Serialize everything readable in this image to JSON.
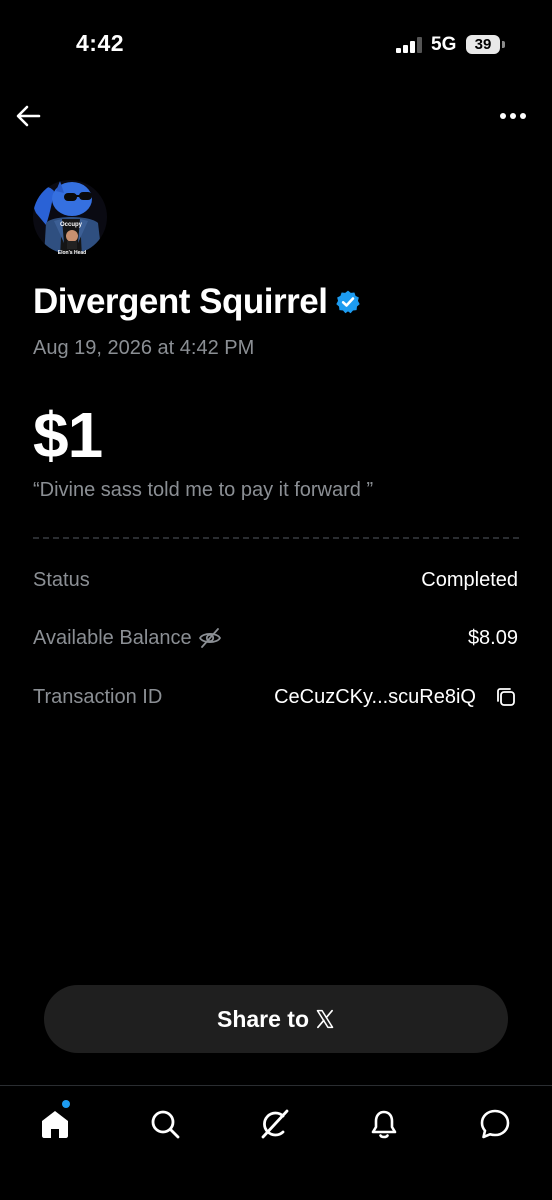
{
  "status_bar": {
    "time": "4:42",
    "network": "5G",
    "battery": "39"
  },
  "nav": {
    "back_icon": "arrow-left-icon",
    "more_icon": "more-horizontal-icon"
  },
  "profile": {
    "avatar_text_top": "Occupy",
    "avatar_text_bottom": "Elon's Head",
    "name": "Divergent Squirrel",
    "verified": true,
    "date": "Aug 19, 2026 at 4:42 PM"
  },
  "payment": {
    "amount": "$1",
    "memo": "“Divine sass told me to pay it forward ”"
  },
  "details": {
    "status_label": "Status",
    "status_value": "Completed",
    "balance_label": "Available Balance",
    "balance_value": "$8.09",
    "txn_label": "Transaction ID",
    "txn_value": "CeCuzCKy...scuRe8iQ"
  },
  "share": {
    "label": "Share to"
  },
  "tabs": [
    "home",
    "search",
    "grok",
    "notifications",
    "messages"
  ],
  "colors": {
    "background": "#000000",
    "muted_text": "#8b8f94",
    "verified_blue": "#1d9bf0",
    "button_bg": "#1f1f1f"
  }
}
